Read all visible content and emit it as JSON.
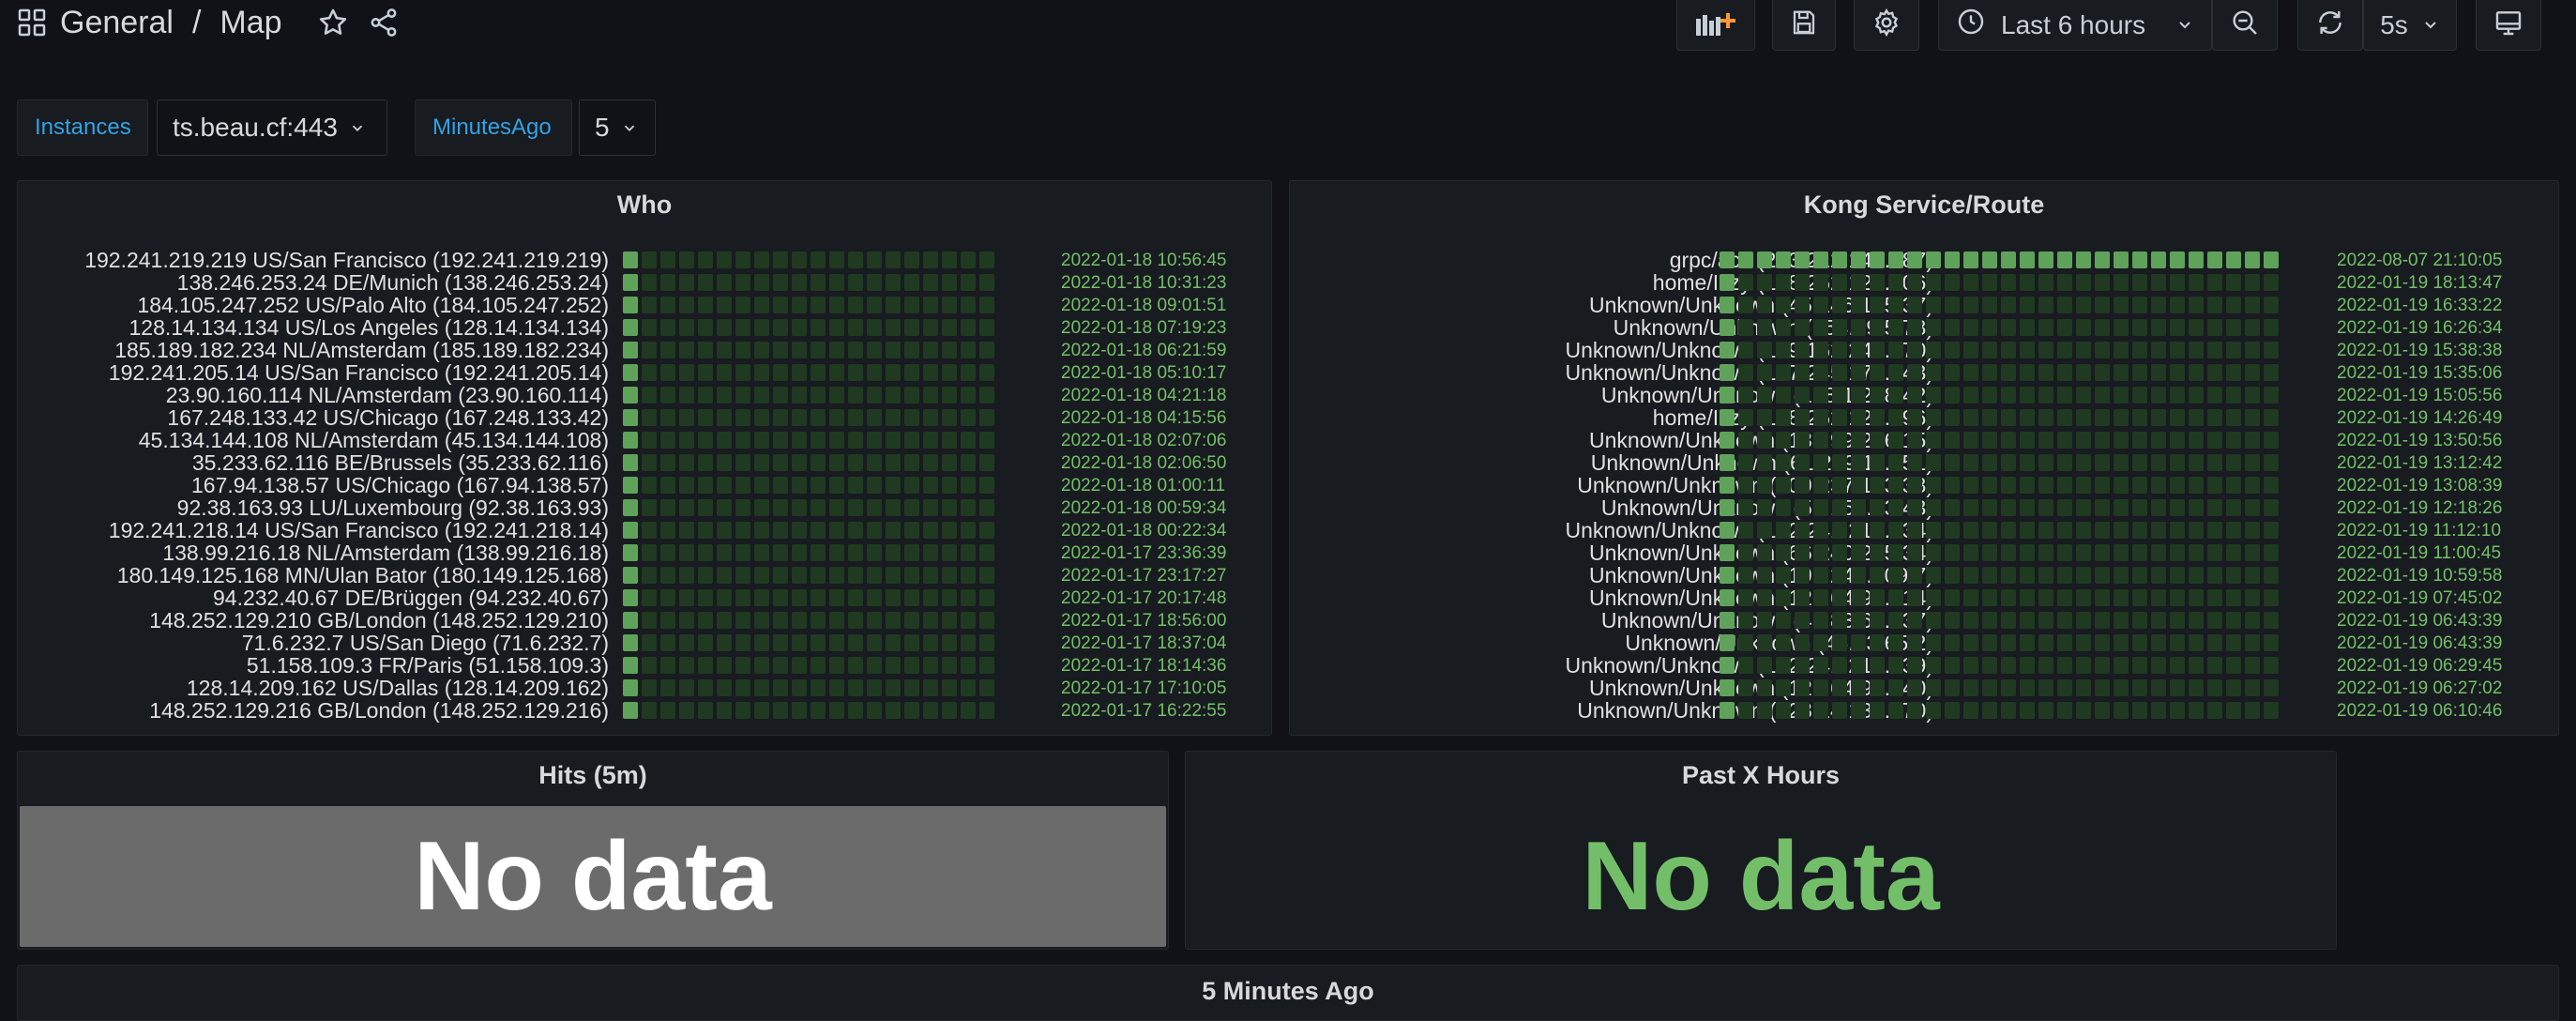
{
  "breadcrumb": {
    "folder": "General",
    "separator": "/",
    "dashboard": "Map"
  },
  "toolbar": {
    "add_panel_icon": "add-panel-icon",
    "save_icon": "save-icon",
    "settings_icon": "gear-icon",
    "time_range": "Last 6 hours",
    "zoom_out_icon": "zoom-out-icon",
    "refresh_icon": "refresh-icon",
    "refresh_interval": "5s",
    "tv_mode_icon": "monitor-icon"
  },
  "variables": [
    {
      "label": "Instances",
      "value": "ts.beau.cf:443"
    },
    {
      "label": "MinutesAgo",
      "value": "5"
    }
  ],
  "who": {
    "title": "Who",
    "rows": [
      {
        "label": "192.241.219.219 US/San Francisco (192.241.219.219)",
        "time": "2022-01-18 10:56:45",
        "active": 1
      },
      {
        "label": "138.246.253.24 DE/Munich (138.246.253.24)",
        "time": "2022-01-18 10:31:23",
        "active": 1
      },
      {
        "label": "184.105.247.252 US/Palo Alto (184.105.247.252)",
        "time": "2022-01-18 09:01:51",
        "active": 1
      },
      {
        "label": "128.14.134.134 US/Los Angeles (128.14.134.134)",
        "time": "2022-01-18 07:19:23",
        "active": 1
      },
      {
        "label": "185.189.182.234 NL/Amsterdam (185.189.182.234)",
        "time": "2022-01-18 06:21:59",
        "active": 1
      },
      {
        "label": "192.241.205.14 US/San Francisco (192.241.205.14)",
        "time": "2022-01-18 05:10:17",
        "active": 1
      },
      {
        "label": "23.90.160.114 NL/Amsterdam (23.90.160.114)",
        "time": "2022-01-18 04:21:18",
        "active": 1
      },
      {
        "label": "167.248.133.42 US/Chicago (167.248.133.42)",
        "time": "2022-01-18 04:15:56",
        "active": 1
      },
      {
        "label": "45.134.144.108 NL/Amsterdam (45.134.144.108)",
        "time": "2022-01-18 02:07:06",
        "active": 1
      },
      {
        "label": "35.233.62.116 BE/Brussels (35.233.62.116)",
        "time": "2022-01-18 02:06:50",
        "active": 1
      },
      {
        "label": "167.94.138.57 US/Chicago (167.94.138.57)",
        "time": "2022-01-18 01:00:11",
        "active": 1
      },
      {
        "label": "92.38.163.93 LU/Luxembourg (92.38.163.93)",
        "time": "2022-01-18 00:59:34",
        "active": 1
      },
      {
        "label": "192.241.218.14 US/San Francisco (192.241.218.14)",
        "time": "2022-01-18 00:22:34",
        "active": 1
      },
      {
        "label": "138.99.216.18 NL/Amsterdam (138.99.216.18)",
        "time": "2022-01-17 23:36:39",
        "active": 1
      },
      {
        "label": "180.149.125.168 MN/Ulan Bator (180.149.125.168)",
        "time": "2022-01-17 23:17:27",
        "active": 1
      },
      {
        "label": "94.232.40.67 DE/Brüggen (94.232.40.67)",
        "time": "2022-01-17 20:17:48",
        "active": 1
      },
      {
        "label": "148.252.129.210 GB/London (148.252.129.210)",
        "time": "2022-01-17 18:56:00",
        "active": 1
      },
      {
        "label": "71.6.232.7 US/San Diego (71.6.232.7)",
        "time": "2022-01-17 18:37:04",
        "active": 1
      },
      {
        "label": "51.158.109.3 FR/Paris (51.158.109.3)",
        "time": "2022-01-17 18:14:36",
        "active": 1
      },
      {
        "label": "128.14.209.162 US/Dallas (128.14.209.162)",
        "time": "2022-01-17 17:10:05",
        "active": 1
      },
      {
        "label": "148.252.129.216 GB/London (148.252.129.216)",
        "time": "2022-01-17 16:22:55",
        "active": 1
      }
    ]
  },
  "kong": {
    "title": "Kong Service/Route",
    "rows": [
      {
        "label": "grpc/ack (203.212.146.187)",
        "time": "2022-08-07 21:10:05",
        "active": 30
      },
      {
        "label": "home/Izzy (148.252.129.206)",
        "time": "2022-01-19 18:13:47",
        "active": 1
      },
      {
        "label": "Unknown/Unknown (45.146.165.37)",
        "time": "2022-01-19 16:33:22",
        "active": 1
      },
      {
        "label": "Unknown/Unknown (154.89.5.78)",
        "time": "2022-01-19 16:26:34",
        "active": 1
      },
      {
        "label": "Unknown/Unknown (139.162.249.170)",
        "time": "2022-01-19 15:38:38",
        "active": 1
      },
      {
        "label": "Unknown/Unknown (157.245.176.143)",
        "time": "2022-01-19 15:35:06",
        "active": 1
      },
      {
        "label": "Unknown/Unknown (128.1.248.42)",
        "time": "2022-01-19 15:05:56",
        "active": 1
      },
      {
        "label": "home/Izzy (148.252.129.196)",
        "time": "2022-01-19 14:26:49",
        "active": 1
      },
      {
        "label": "Unknown/Unknown (138.99.216.15)",
        "time": "2022-01-19 13:50:56",
        "active": 1
      },
      {
        "label": "Unknown/Unknown (61.219.11.151)",
        "time": "2022-01-19 13:12:42",
        "active": 1
      },
      {
        "label": "Unknown/Unknown (109.237.103.38)",
        "time": "2022-01-19 13:08:39",
        "active": 1
      },
      {
        "label": "Unknown/Unknown (51.159.23.43)",
        "time": "2022-01-19 12:18:26",
        "active": 1
      },
      {
        "label": "Unknown/Unknown (192.241.219.134)",
        "time": "2022-01-19 11:12:10",
        "active": 1
      },
      {
        "label": "Unknown/Unknown (66.240.205.34)",
        "time": "2022-01-19 11:00:45",
        "active": 1
      },
      {
        "label": "Unknown/Unknown (192.241.209.7)",
        "time": "2022-01-19 10:59:58",
        "active": 1
      },
      {
        "label": "Unknown/Unknown (125.64.94.214)",
        "time": "2022-01-19 07:45:02",
        "active": 1
      },
      {
        "label": "Unknown/Unknown (45.83.65.137)",
        "time": "2022-01-19 06:43:39",
        "active": 1
      },
      {
        "label": "Unknown/Unknown (45.83.65.2)",
        "time": "2022-01-19 06:43:39",
        "active": 1
      },
      {
        "label": "Unknown/Unknown (192.241.214.239)",
        "time": "2022-01-19 06:29:45",
        "active": 1
      },
      {
        "label": "Unknown/Unknown (125.64.94.140)",
        "time": "2022-01-19 06:27:02",
        "active": 1
      },
      {
        "label": "Unknown/Unknown (128.14.134.170)",
        "time": "2022-01-19 06:10:46",
        "active": 1
      }
    ]
  },
  "hits": {
    "title": "Hits (5m)",
    "value": "No data",
    "background": "#6b6b6b",
    "text_color": "#ffffff"
  },
  "past_hours": {
    "title": "Past X Hours",
    "value": "No data",
    "text_color": "#73bf69"
  },
  "five_minutes": {
    "title": "5 Minutes Ago"
  },
  "colors": {
    "cell_on": "#5fa35a",
    "cell_off": "#1f3a21",
    "time_text": "#73bf69"
  }
}
